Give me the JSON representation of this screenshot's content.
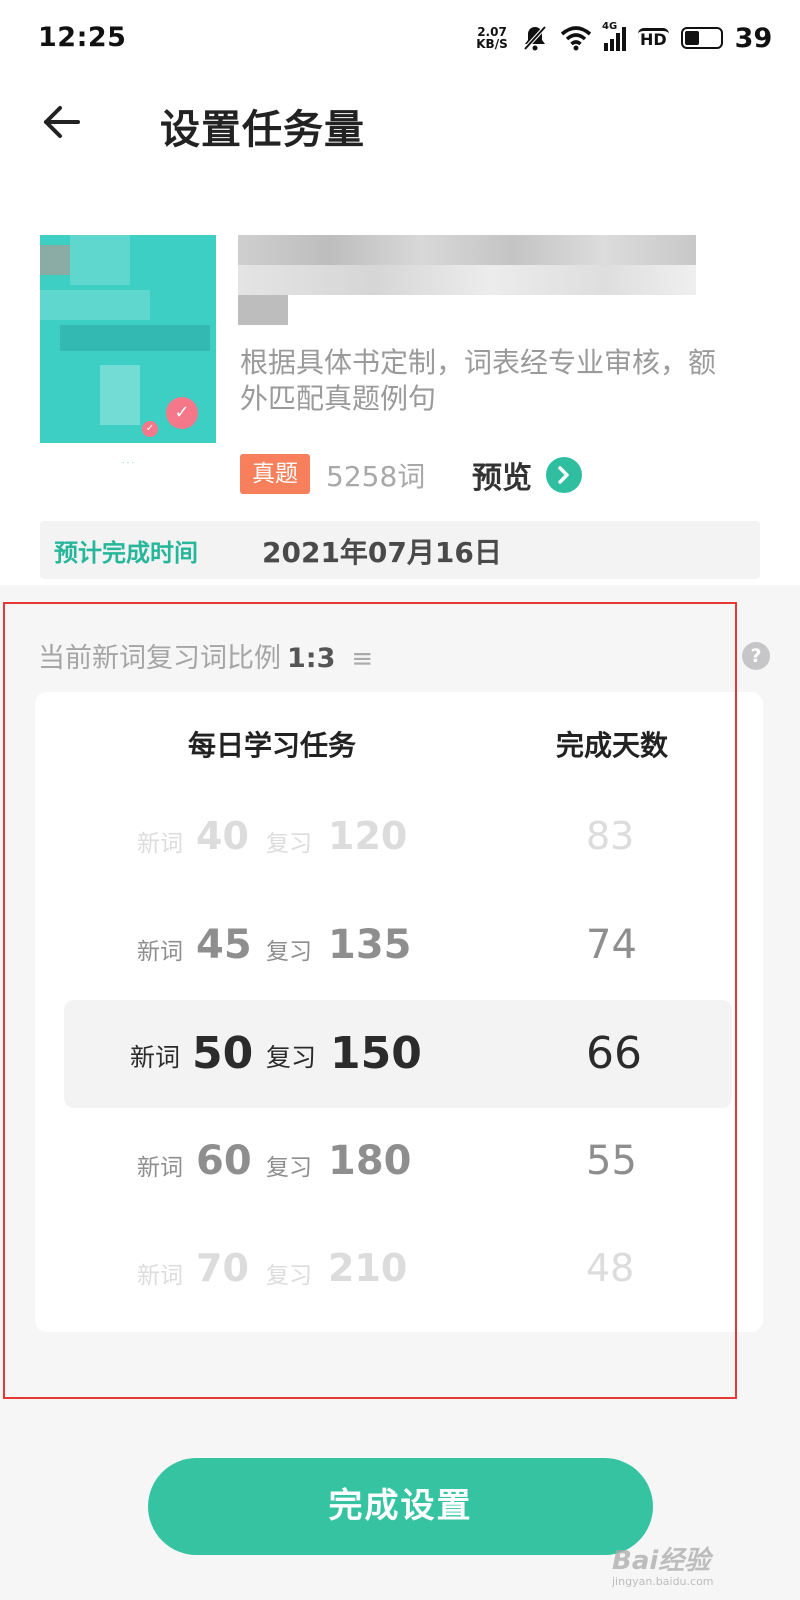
{
  "status_bar": {
    "time": "12:25",
    "speed_value": "2.07",
    "speed_unit": "KB/S",
    "network": "4G",
    "hd": "HD",
    "battery": "39"
  },
  "header": {
    "title": "设置任务量"
  },
  "book": {
    "description": "根据具体书定制，词表经专业审核，额外匹配真题例句",
    "tag": "真题",
    "word_count": "5258词",
    "preview_label": "预览"
  },
  "estimate": {
    "label": "预计完成时间",
    "date": "2021年07月16日"
  },
  "ratio": {
    "label": "当前新词复习词比例",
    "value": "1:3",
    "menu_icon": "≡",
    "help_icon": "?"
  },
  "picker": {
    "col_task": "每日学习任务",
    "col_days": "完成天数",
    "new_label": "新词",
    "review_label": "复习",
    "rows": [
      {
        "new": "40",
        "review": "120",
        "days": "83"
      },
      {
        "new": "45",
        "review": "135",
        "days": "74"
      },
      {
        "new": "50",
        "review": "150",
        "days": "66"
      },
      {
        "new": "60",
        "review": "180",
        "days": "55"
      },
      {
        "new": "70",
        "review": "210",
        "days": "48"
      }
    ],
    "selected_index": 2
  },
  "footer": {
    "done_label": "完成设置"
  },
  "watermark": {
    "main": "Bai经验",
    "sub": "jingyan.baidu.com"
  },
  "colors": {
    "accent": "#35c3a1",
    "tag": "#f77f5b",
    "highlight_frame": "#e53935"
  }
}
